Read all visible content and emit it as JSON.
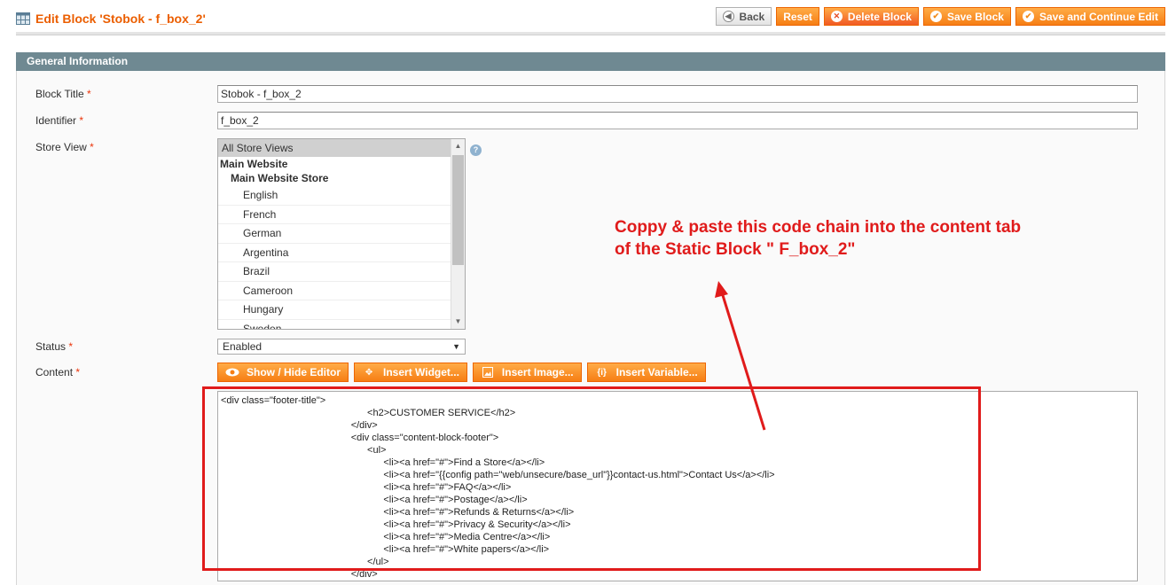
{
  "header": {
    "title": "Edit Block 'Stobok - f_box_2'",
    "buttons": {
      "back": "Back",
      "reset": "Reset",
      "delete": "Delete Block",
      "save": "Save Block",
      "save_continue": "Save and Continue Edit"
    }
  },
  "section": {
    "title": "General Information"
  },
  "form": {
    "block_title": {
      "label": "Block Title",
      "value": "Stobok - f_box_2"
    },
    "identifier": {
      "label": "Identifier",
      "value": "f_box_2"
    },
    "store_view": {
      "label": "Store View",
      "selected": "All Store Views",
      "group": "Main Website",
      "subgroup": "Main Website Store",
      "stores": [
        "English",
        "French",
        "German",
        "Argentina",
        "Brazil",
        "Cameroon",
        "Hungary",
        "Sweden"
      ]
    },
    "status": {
      "label": "Status",
      "value": "Enabled"
    },
    "content": {
      "label": "Content",
      "buttons": {
        "toggle_editor": "Show / Hide Editor",
        "insert_widget": "Insert Widget...",
        "insert_image": "Insert Image...",
        "insert_variable": "Insert Variable..."
      },
      "lines": [
        "<div class=\"footer-title\">",
        "\t\t\t\t\t\t\t\t\t<h2>CUSTOMER SERVICE</h2>",
        "\t\t\t\t\t\t\t\t</div>",
        "\t\t\t\t\t\t\t\t<div class=\"content-block-footer\">",
        "\t\t\t\t\t\t\t\t\t<ul>",
        "\t\t\t\t\t\t\t\t\t\t<li><a href=\"#\">Find a Store</a></li>",
        "\t\t\t\t\t\t\t\t\t\t<li><a href=\"{{config path=\"web/unsecure/base_url\"}}contact-us.html\">Contact Us</a></li>",
        "\t\t\t\t\t\t\t\t\t\t<li><a href=\"#\">FAQ</a></li>",
        "\t\t\t\t\t\t\t\t\t\t<li><a href=\"#\">Postage</a></li>",
        "\t\t\t\t\t\t\t\t\t\t<li><a href=\"#\">Refunds & Returns</a></li>",
        "\t\t\t\t\t\t\t\t\t\t<li><a href=\"#\">Privacy & Security</a></li>",
        "\t\t\t\t\t\t\t\t\t\t<li><a href=\"#\">Media Centre</a></li>",
        "\t\t\t\t\t\t\t\t\t\t<li><a href=\"#\">White papers</a></li>",
        "\t\t\t\t\t\t\t\t\t</ul>",
        "\t\t\t\t\t\t\t\t</div>"
      ]
    }
  },
  "annotation": {
    "line1": "Coppy & paste this code chain into the content tab",
    "line2": "of the Static Block \" F_box_2\"",
    "color": "#e01b1b"
  },
  "colors": {
    "accent": "#eb5e00",
    "section_bar": "#6f8992",
    "button": "#f67e14"
  }
}
